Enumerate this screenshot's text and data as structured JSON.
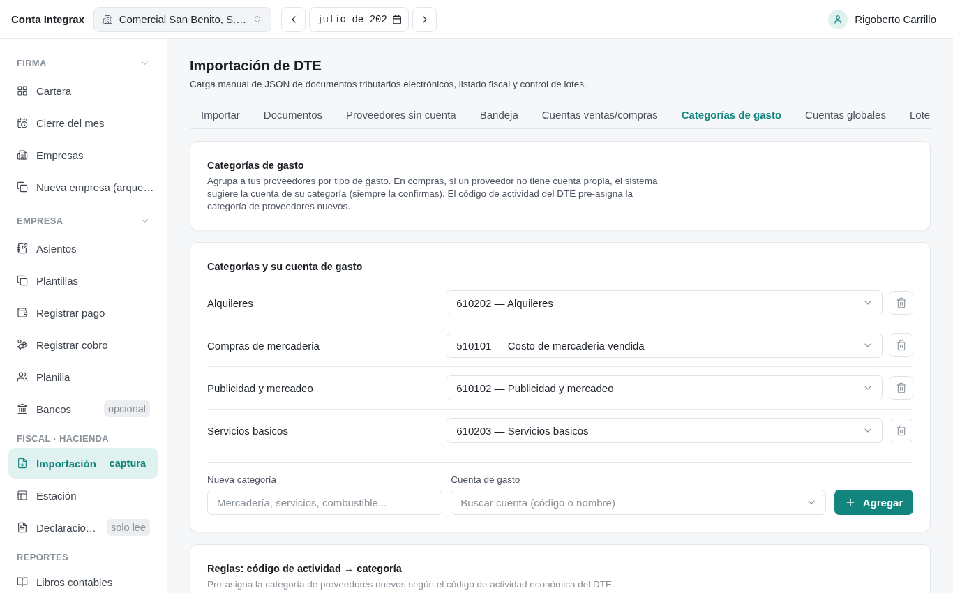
{
  "header": {
    "app_name": "Conta Integrax",
    "company": "Comercial San Benito, S.…",
    "period": "julio de 202",
    "user": "Rigoberto Carrillo"
  },
  "sidebar": {
    "sections": [
      {
        "title": "FIRMA",
        "expanded": true,
        "items": [
          {
            "label": "Cartera",
            "selected": false
          },
          {
            "label": "Cierre del mes",
            "selected": false
          },
          {
            "label": "Empresas",
            "selected": false
          },
          {
            "label": "Nueva empresa (arque…",
            "selected": false
          }
        ]
      },
      {
        "title": "EMPRESA",
        "expanded": true,
        "items": [
          {
            "label": "Asientos",
            "selected": false
          },
          {
            "label": "Plantillas",
            "selected": false
          },
          {
            "label": "Registrar pago",
            "selected": false
          },
          {
            "label": "Registrar cobro",
            "selected": false
          },
          {
            "label": "Planilla",
            "selected": false
          },
          {
            "label": "Bancos",
            "selected": false,
            "badge": "opcional"
          }
        ]
      },
      {
        "title": "FISCAL · HACIENDA",
        "items": [
          {
            "label": "Importación",
            "selected": true,
            "badge": "captura"
          },
          {
            "label": "Estación",
            "selected": false
          },
          {
            "label": "Declaracio…",
            "selected": false,
            "badge": "solo lee"
          }
        ]
      },
      {
        "title": "REPORTES",
        "items": [
          {
            "label": "Libros contables",
            "selected": false
          }
        ]
      }
    ]
  },
  "page": {
    "title": "Importación de DTE",
    "subtitle": "Carga manual de JSON de documentos tributarios electrónicos, listado fiscal y control de lotes."
  },
  "tabs": [
    {
      "label": "Importar",
      "selected": false
    },
    {
      "label": "Documentos",
      "selected": false
    },
    {
      "label": "Proveedores sin cuenta",
      "selected": false
    },
    {
      "label": "Bandeja",
      "selected": false
    },
    {
      "label": "Cuentas ventas/compras",
      "selected": false
    },
    {
      "label": "Categorías de gasto",
      "selected": true
    },
    {
      "label": "Cuentas globales",
      "selected": false
    },
    {
      "label": "Lote",
      "selected": false
    }
  ],
  "intro_card": {
    "title": "Categorías de gasto",
    "text": "Agrupa a tus proveedores por tipo de gasto. En compras, si un proveedor no tiene cuenta propia, el sistema sugiere la cuenta de su categoría (siempre la confirmas). El código de actividad del DTE pre-asigna la categoría de proveedores nuevos."
  },
  "categories_card": {
    "title": "Categorías y su cuenta de gasto",
    "rows": [
      {
        "category": "Alquileres",
        "account": "610202 — Alquileres"
      },
      {
        "category": "Compras de mercaderia",
        "account": "510101 — Costo de mercaderia vendida"
      },
      {
        "category": "Publicidad y mercadeo",
        "account": "610102 — Publicidad y mercadeo"
      },
      {
        "category": "Servicios basicos",
        "account": "610203 — Servicios basicos"
      }
    ],
    "new_category": {
      "label": "Nueva categoría",
      "placeholder": "Mercadería, servicios, combustible..."
    },
    "expense_account": {
      "label": "Cuenta de gasto",
      "placeholder": "Buscar cuenta (código o nombre)"
    },
    "add_button": "Agregar"
  },
  "rules_card": {
    "title": "Reglas: código de actividad → categoría",
    "text": "Pre-asigna la categoría de proveedores nuevos según el código de actividad económica del DTE."
  }
}
